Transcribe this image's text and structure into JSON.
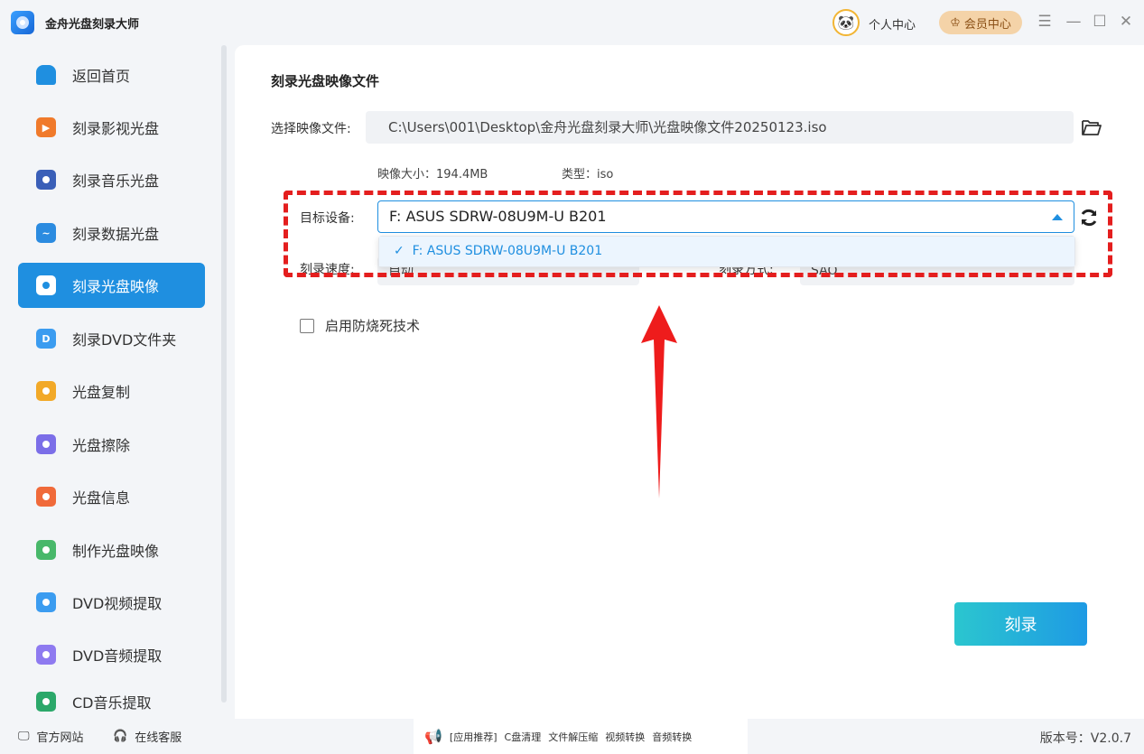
{
  "app": {
    "title": "金舟光盘刻录大师",
    "personal_center": "个人中心",
    "vip_center": "会员中心"
  },
  "sidebar": {
    "items": [
      {
        "label": "返回首页",
        "icon": "home-icon",
        "color": "#1f8fe0"
      },
      {
        "label": "刻录影视光盘",
        "icon": "video-disc-icon",
        "color": "#f07a2b"
      },
      {
        "label": "刻录音乐光盘",
        "icon": "music-disc-icon",
        "color": "#3a5fb8"
      },
      {
        "label": "刻录数据光盘",
        "icon": "data-disc-icon",
        "color": "#2b8be0"
      },
      {
        "label": "刻录光盘映像",
        "icon": "image-disc-icon",
        "color": "#ffffff",
        "active": true
      },
      {
        "label": "刻录DVD文件夹",
        "icon": "dvd-folder-icon",
        "color": "#3b9cf0"
      },
      {
        "label": "光盘复制",
        "icon": "disc-copy-icon",
        "color": "#f2a928"
      },
      {
        "label": "光盘擦除",
        "icon": "disc-erase-icon",
        "color": "#7b6ee8"
      },
      {
        "label": "光盘信息",
        "icon": "disc-info-icon",
        "color": "#f06a3a"
      },
      {
        "label": "制作光盘映像",
        "icon": "make-image-icon",
        "color": "#48b86a"
      },
      {
        "label": "DVD视频提取",
        "icon": "dvd-video-extract-icon",
        "color": "#3b9cf0"
      },
      {
        "label": "DVD音频提取",
        "icon": "dvd-audio-extract-icon",
        "color": "#8e7af0"
      },
      {
        "label": "CD音乐提取",
        "icon": "cd-music-extract-icon",
        "color": "#2ba86a"
      }
    ]
  },
  "main": {
    "section_title": "刻录光盘映像文件",
    "image_file_label": "选择映像文件:",
    "image_file_path": "C:\\Users\\001\\Desktop\\金舟光盘刻录大师\\光盘映像文件20250123.iso",
    "image_size": "映像大小：194.4MB",
    "image_type": "类型：iso",
    "target_device_label": "目标设备:",
    "target_device_value": "F: ASUS SDRW-08U9M-U B201",
    "dropdown_option": "F: ASUS SDRW-08U9M-U B201",
    "burn_speed_label": "刻录速度:",
    "burn_speed_value": "自动",
    "burn_mode_label": "刻录方式:",
    "burn_mode_value": "SAO",
    "anti_burn_label": "启用防烧死技术",
    "burn_button": "刻录"
  },
  "footer": {
    "official_site": "官方网站",
    "online_service": "在线客服",
    "promo_prefix": "[应用推荐]",
    "promo_items": [
      "C盘清理",
      "文件解压缩",
      "视频转换",
      "音频转换"
    ],
    "version": "版本号：V2.0.7"
  },
  "colors": {
    "accent": "#1f8fe0",
    "highlight_frame": "#e41e1e",
    "burn_button_start": "#2bc6cf",
    "burn_button_end": "#1e9ae4"
  }
}
